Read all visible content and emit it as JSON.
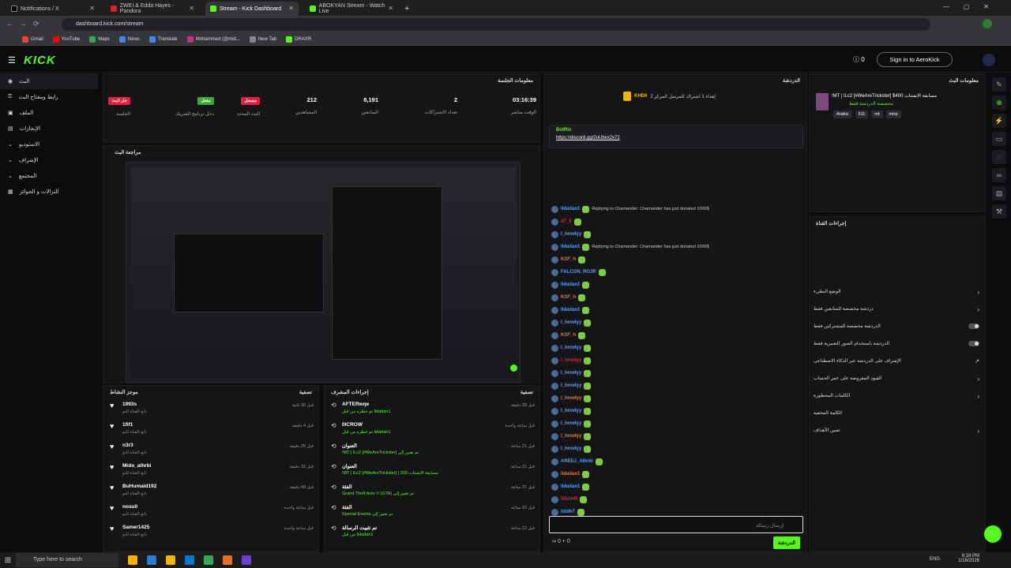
{
  "tabs": [
    {
      "label": "Notifications / X"
    },
    {
      "label": "ZWEI & Edda Hayes - Pandora"
    },
    {
      "label": "Stream - Kick Dashboard"
    },
    {
      "label": "ABOKYAN Stream - Watch Live"
    }
  ],
  "url": "dashboard.kick.com/stream",
  "bookmarks": [
    "Gmail",
    "YouTube",
    "Maps",
    "News",
    "Translate",
    "Mohammed (@mid...",
    "New Tab",
    "DRAXR"
  ],
  "nav": {
    "logo": "KICK",
    "signin": "Sign in to AeroKick",
    "notif_count": "0"
  },
  "sidebar": [
    "البث",
    "رابط ومفتاح البث",
    "الملف",
    "الإنجازات",
    "الاستوديو",
    "الإشراف",
    "المجتمع",
    "التزالات و الجوائز"
  ],
  "session": {
    "title": "معلومات الجلسة",
    "stats": [
      {
        "value": "03:16:39",
        "label": "الوقت مباشر"
      },
      {
        "value": "2",
        "label": "تعداد الاشتراكات"
      },
      {
        "value": "8,191",
        "label": "المتابعين"
      },
      {
        "value": "212",
        "label": "المشاهدين"
      },
      {
        "value": "مسجل",
        "label": "البث المحدد"
      },
      {
        "value": "مفعل",
        "label": "دخل برنامج الشريك"
      },
      {
        "value": "جار البث",
        "label": "الجلسة"
      }
    ]
  },
  "preview": {
    "title": "مراجعة البث"
  },
  "activity": {
    "title": "موجز النشاط",
    "filter": "تصفية",
    "items": [
      {
        "user": "1993s",
        "sub": "تابع القناة للتو",
        "time": "قبل 30 ثانية"
      },
      {
        "user": "1fif1",
        "sub": "تابع القناة للتو",
        "time": "قبل 4 دقيقة"
      },
      {
        "user": "n3r3",
        "sub": "تابع القناة للتو",
        "time": "قبل 25 دقيقة"
      },
      {
        "user": "Mido_alhrbi",
        "sub": "تابع القناة للتو",
        "time": "قبل 32 دقيقة"
      },
      {
        "user": "BuHumaid192",
        "sub": "تابع القناة للتو",
        "time": "قبل 49 دقيقة"
      },
      {
        "user": "nosu0",
        "sub": "تابع القناة للتو",
        "time": "قبل ساعة واحدة"
      },
      {
        "user": "Samer1425",
        "sub": "تابع القناة للتو",
        "time": "قبل ساعة واحدة"
      }
    ]
  },
  "modactions": {
    "title": "إجراءات المشرف",
    "filter": "تصفية",
    "items": [
      {
        "user": "AFTERwqe",
        "detail": "تم حظره من قبل lidadan1",
        "time": "قبل 39 دقيقة"
      },
      {
        "user": "0ICROW",
        "detail": "تم حظره من قبل lidadan1",
        "time": "قبل ساعة واحدة"
      },
      {
        "user": "العنوان",
        "detail": "!MT | lLc2 [#WeAreTrickster] تم تغيير إلى",
        "time": "قبل 21 ساعة"
      },
      {
        "user": "العنوان",
        "detail": "!MT | lLc2 [#WeAreTrickster] | مسابقة الايفنتات 300",
        "time": "قبل 21 ساعة"
      },
      {
        "user": "الفئة",
        "detail": "Grand Theft Auto V (GTA) تم تغيير إلى",
        "time": "قبل 21 ساعة"
      },
      {
        "user": "الفئة",
        "detail": "Special Events تم تغيير إلى",
        "time": "قبل 22 ساعة"
      },
      {
        "user": "تم تثبيت الرسالة",
        "detail": "من قبل lidadan1",
        "time": "قبل 22 ساعة"
      }
    ]
  },
  "chat": {
    "title": "الدردشة",
    "pinned_user": "KHD6",
    "pinned_text": "إهداء 1 اشتراك للمرسل المركز 2",
    "bot_user": "BotRix",
    "bot_text": "https://discord.gg/2uUbxx2x72",
    "lines": [
      {
        "user": "lidadan1",
        "text": "Replying to Chamander: Chamander has just donated 1000$"
      },
      {
        "user": "d7_li",
        "text": ""
      },
      {
        "user": "l_hnodyy",
        "text": ""
      },
      {
        "user": "lidadan1",
        "text": "Replying to Chamander: Chamander has just donated 1000$"
      },
      {
        "user": "KSF_h",
        "text": ""
      },
      {
        "user": "FALCON_ROJR",
        "text": ""
      },
      {
        "user": "lidadan1",
        "text": ""
      },
      {
        "user": "KSF_h",
        "text": ""
      },
      {
        "user": "lidadan1",
        "text": ""
      },
      {
        "user": "l_hnodyy",
        "text": ""
      },
      {
        "user": "KSF_h",
        "text": ""
      },
      {
        "user": "l_hnodyy",
        "text": ""
      },
      {
        "user": "l_hnodyy",
        "text": ""
      },
      {
        "user": "l_hnodyy",
        "text": ""
      },
      {
        "user": "l_hnodyy",
        "text": ""
      },
      {
        "user": "l_hnodyy",
        "text": ""
      },
      {
        "user": "l_hnodyy",
        "text": ""
      },
      {
        "user": "l_hnodyy",
        "text": ""
      },
      {
        "user": "l_hnodyy",
        "text": ""
      },
      {
        "user": "l_hnodyy",
        "text": ""
      },
      {
        "user": "AREEJ_Alhrbi",
        "text": ""
      },
      {
        "user": "lidadan1",
        "text": ""
      },
      {
        "user": "lidadan1",
        "text": ""
      },
      {
        "user": "SDAHR",
        "text": ""
      },
      {
        "user": "hitdh7",
        "text": ""
      }
    ],
    "input_placeholder": "إرسال رسالة",
    "send_label": "الدردشة",
    "footer_count_a": "0",
    "footer_count_b": "0"
  },
  "streaminfo": {
    "title": "معلومات البث",
    "stream_title": "!MT | lLc2 [#WeAreTrickster] $400 مسابقة الايفنتات",
    "category": "مخصصة الدردشة فقط",
    "tags": [
      "Arabic",
      "511",
      "mt",
      "mtrp"
    ]
  },
  "channel": {
    "title": "إجراءات القناة",
    "items": [
      {
        "label": "الوضع البطيء"
      },
      {
        "label": "دردشة مخصصة للمتابعين فقط"
      },
      {
        "label": "الدردشة مخصصة للمشتركين فقط"
      },
      {
        "label": "الدردشة باستخدام الصور التعبيرية فقط"
      },
      {
        "label": "الإشراف على الدردشة عبر الذكاء الاصطناعي"
      },
      {
        "label": "القيود المفروضة على عمر الحساب"
      },
      {
        "label": "الكلمات المحظورة"
      },
      {
        "label": "الكلمة المخفية"
      },
      {
        "label": "تعيين الأهداف"
      }
    ]
  },
  "taskbar": {
    "search": "Type here to search",
    "time": "6:18 PM",
    "date": "1/18/2026",
    "lang": "ENG"
  },
  "colors": {
    "accent": "#53fc18",
    "red": "#e91e3c",
    "bg": "#0b0c0e",
    "panel": "#141517"
  }
}
